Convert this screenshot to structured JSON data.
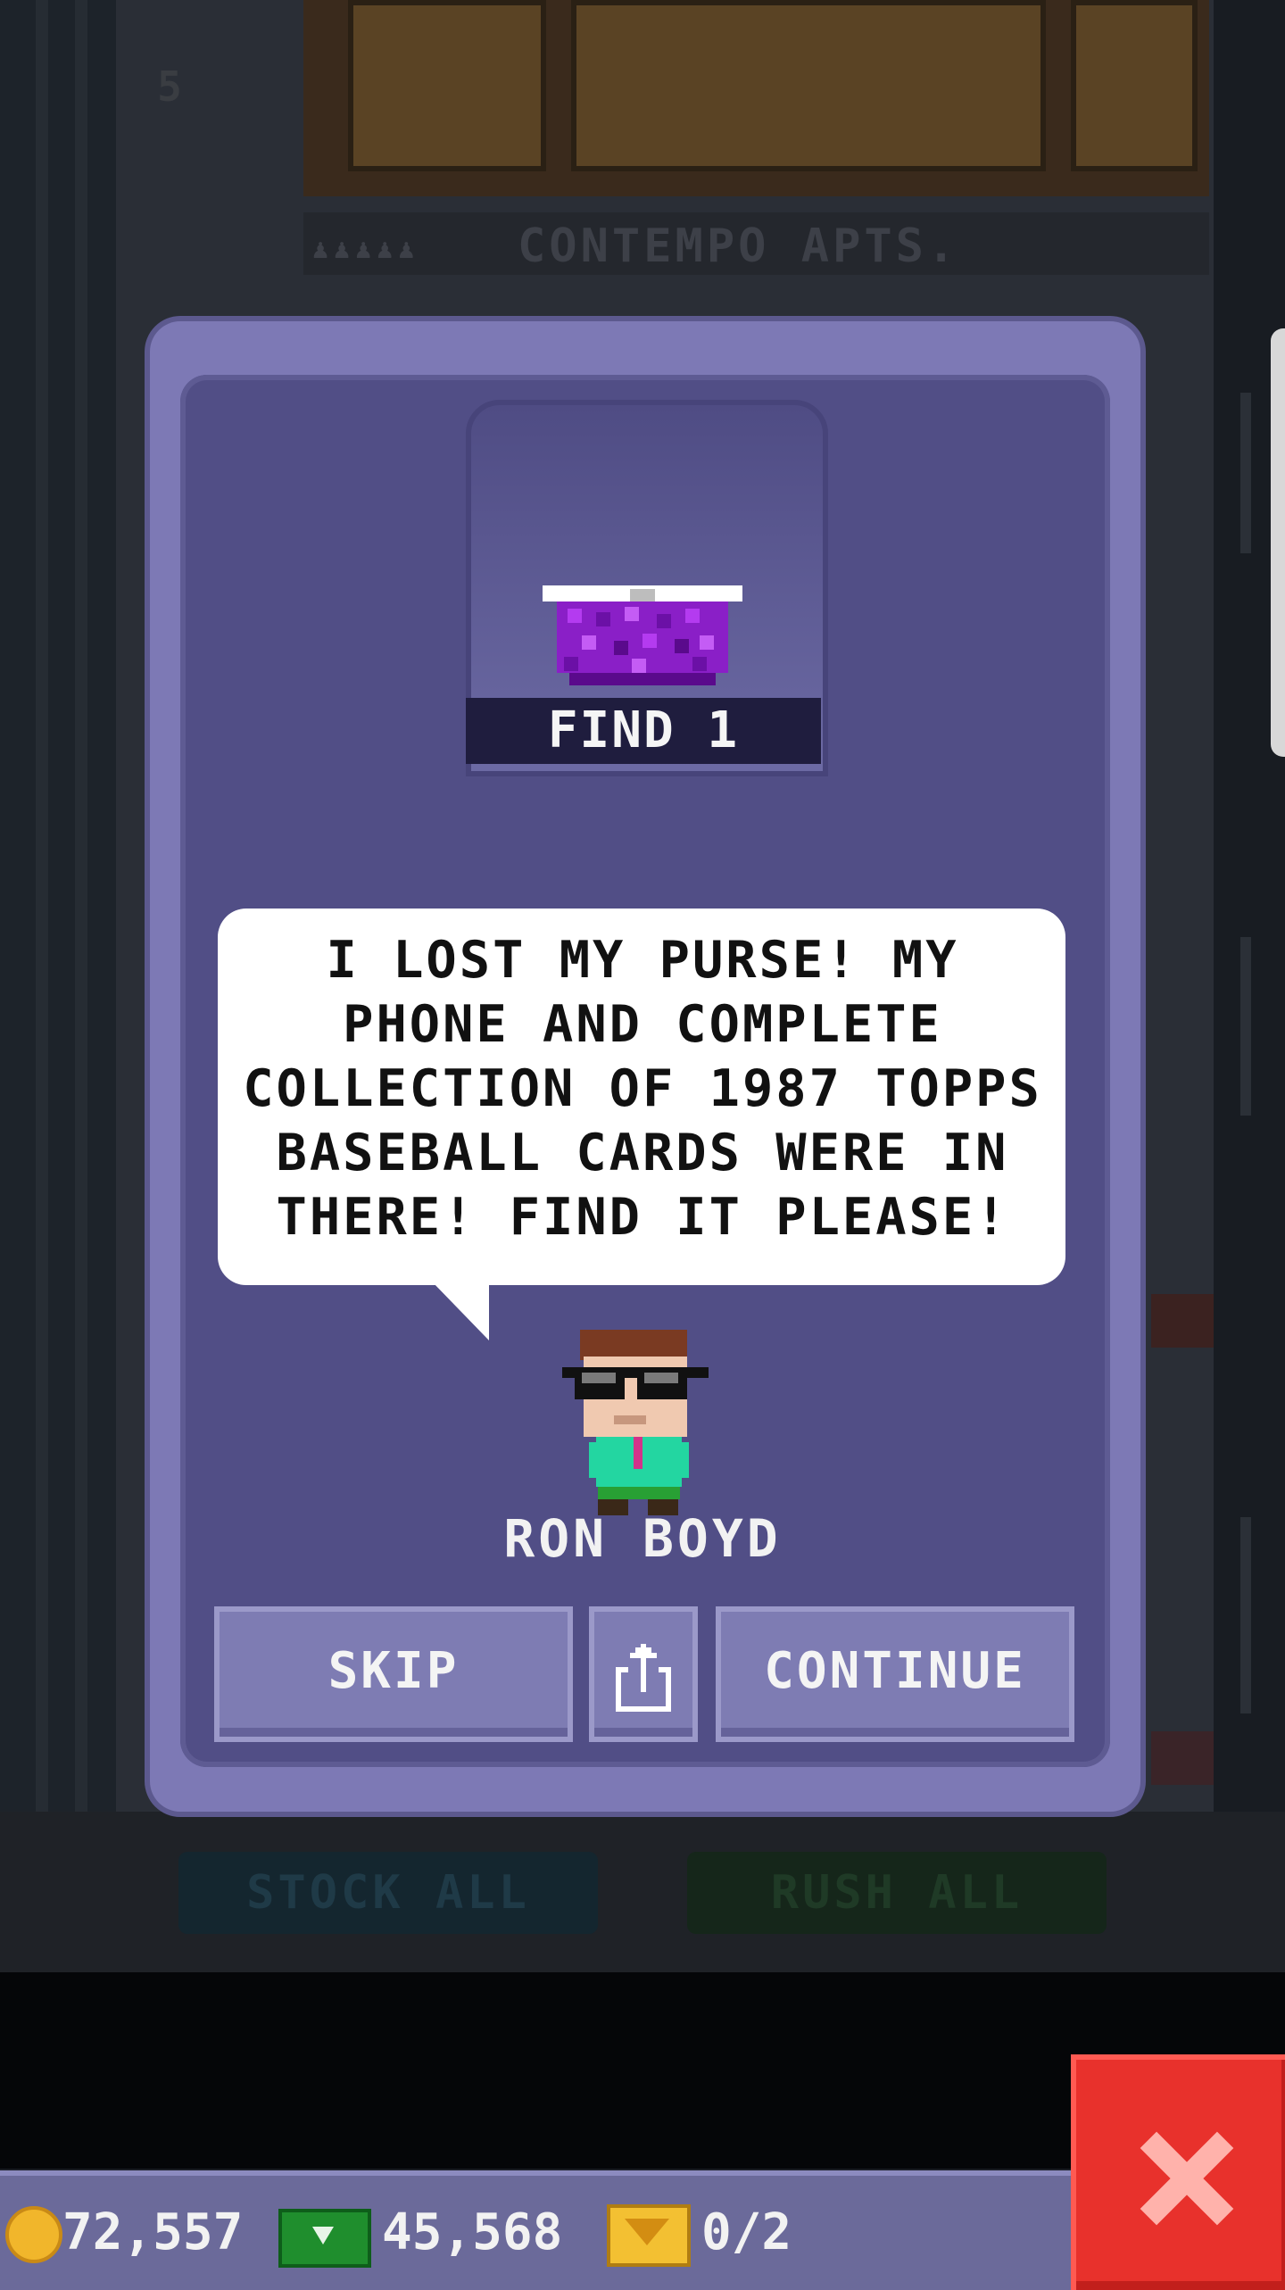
{
  "background": {
    "floor_number": "5",
    "floor_name": "CONTEMPO APTS.",
    "stock_all_label": "STOCK ALL",
    "rush_all_label": "RUSH ALL"
  },
  "mission": {
    "item_icon": "purple-purse",
    "find_label": "FIND 1",
    "message": "I LOST MY PURSE! MY PHONE AND COMPLETE COLLECTION OF 1987 TOPPS BASEBALL CARDS WERE IN THERE! FIND IT PLEASE!",
    "character_name": "RON BOYD",
    "skip_label": "SKIP",
    "share_icon": "share-icon",
    "continue_label": "CONTINUE"
  },
  "currency": {
    "coins": "72,557",
    "bux_cash": "45,568",
    "tickets": "0/2"
  },
  "colors": {
    "modal": "#7d79b5",
    "modal_inner": "#514e86",
    "close_button": "#e8312c",
    "currency_bar": "#6b6a9a"
  }
}
